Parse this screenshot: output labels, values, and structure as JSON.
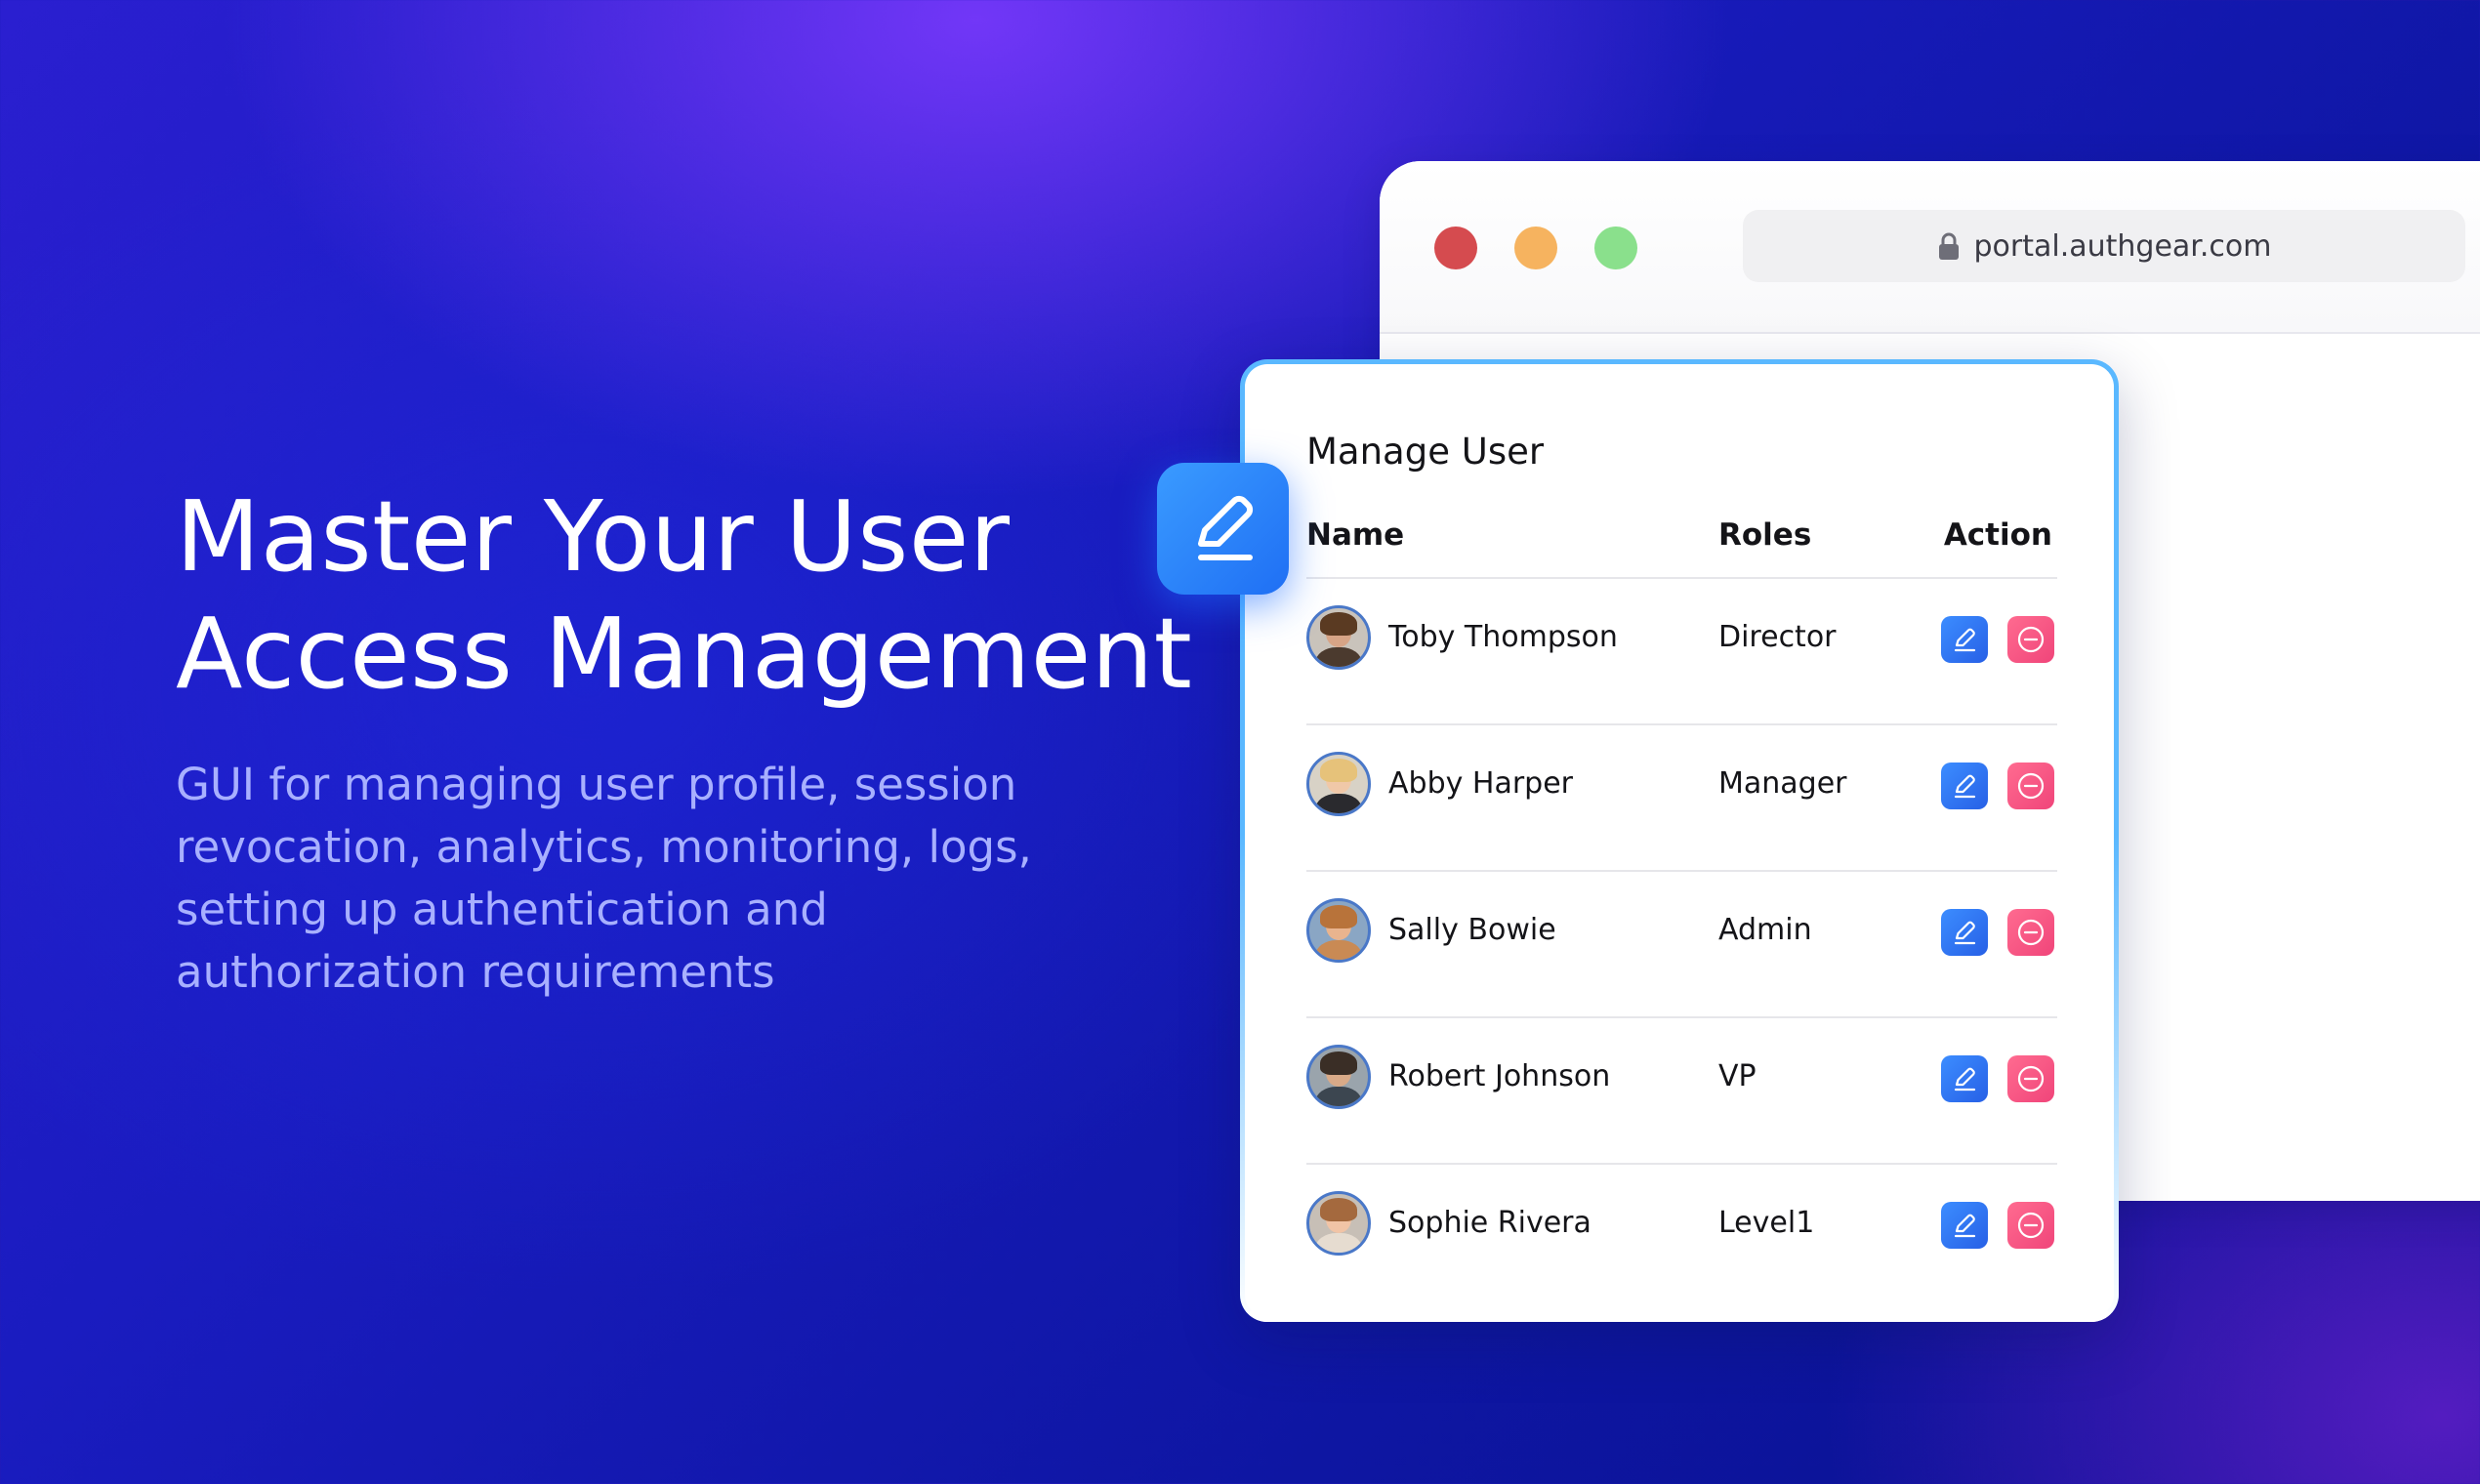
{
  "hero": {
    "title_line1": "Master Your User",
    "title_line2": "Access Management",
    "description": "GUI for managing user profile, session revocation, analytics, monitoring, logs, setting up authentication and authorization requirements"
  },
  "browser": {
    "url": "portal.authgear.com",
    "controls": [
      "close",
      "minimize",
      "maximize"
    ],
    "control_colors": {
      "close": "#d54b4f",
      "minimize": "#f6b35f",
      "maximize": "#8ae08c"
    }
  },
  "card": {
    "title": "Manage User",
    "columns": {
      "name": "Name",
      "roles": "Roles",
      "action": "Action"
    },
    "users": [
      {
        "name": "Toby Thompson",
        "role": "Director"
      },
      {
        "name": "Abby Harper",
        "role": "Manager"
      },
      {
        "name": "Sally Bowie",
        "role": "Admin"
      },
      {
        "name": "Robert Johnson",
        "role": "VP"
      },
      {
        "name": "Sophie Rivera",
        "role": "Level1"
      }
    ],
    "actions": {
      "edit_icon": "pencil-icon",
      "remove_icon": "minus-circle-icon"
    }
  },
  "colors": {
    "accent_blue": "#2760e6",
    "remove_pink": "#f0457a",
    "card_border": "#5ab8ff",
    "hero_desc": "#a8b0ff"
  }
}
